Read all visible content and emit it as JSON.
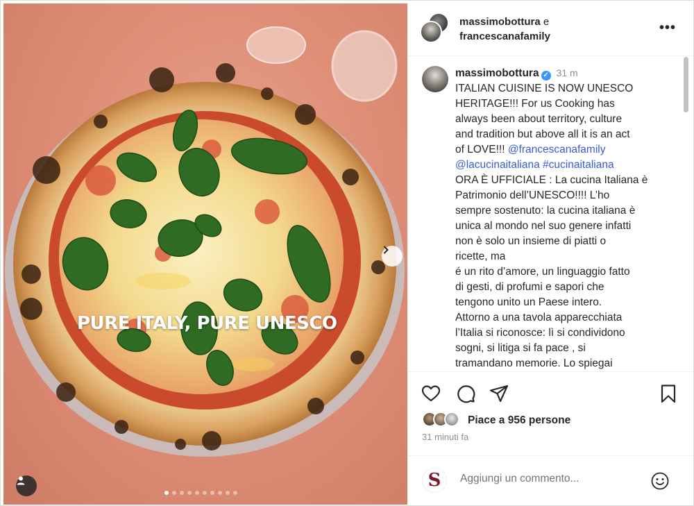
{
  "media": {
    "overlay_text": "PURE ITALY, PURE UNESCO",
    "carousel": {
      "total": 10,
      "active_index": 0
    }
  },
  "header": {
    "user1": "massimobottura",
    "conj": " e",
    "user2": "francescanafamily",
    "more_label": "•••"
  },
  "caption": {
    "username": "massimobottura",
    "time": "31 m",
    "lines": [
      "ITALIAN CUISINE IS NOW UNESCO",
      "HERITAGE!!! For us Cooking has",
      "always been about territory, culture",
      "and tradition but above all it is an act",
      "of LOVE!!! ",
      "@lacucinaitaliana #cucinaitaliana",
      "ORA È UFFICIALE : La cucina Italiana è",
      "Patrimonio dell’UNESCO!!!! L’ho",
      "sempre sostenuto: la cucina italiana è",
      "unica al mondo nel suo genere infatti",
      "non è solo un insieme di piatti o",
      "ricette, ma",
      "é  un rito d’amore, un linguaggio fatto",
      "di gesti, di profumi e sapori che",
      "tengono unito un Paese intero.",
      "Attorno a una tavola apparecchiata",
      "l’Italia si riconosce: lì si condividono",
      "sogni, si litiga si fa pace , si",
      "tramandano memorie. Lo spiegai"
    ],
    "mention_inline": "@francescanafamily"
  },
  "actions": {
    "likes_text": "Piace a 956 persone",
    "time_ago": "31 minuti fa"
  },
  "comment": {
    "avatar_letter": "S",
    "placeholder": "Aggiungi un commento..."
  },
  "colors": {
    "link": "#3b5ad1",
    "verified": "#3897f0",
    "avatar_brand": "#7a1a2a"
  }
}
